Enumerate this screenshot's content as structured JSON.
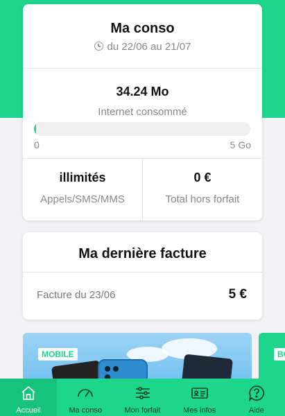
{
  "conso_card": {
    "title": "Ma conso",
    "period": "du 22/06 au 21/07",
    "data_used": "34.24 Mo",
    "data_caption": "Internet consommé",
    "usage_fraction": 0.0067,
    "range_min": "0",
    "range_max": "5 Go",
    "calls_value": "illimités",
    "calls_label": "Appels/SMS/MMS",
    "extra_value": "0 €",
    "extra_label": "Total hors forfait"
  },
  "facture_card": {
    "title": "Ma dernière facture",
    "row_label": "Facture du 23/06",
    "row_amount": "5 €"
  },
  "promo": {
    "tag": "MOBILE",
    "second_tag": "BO"
  },
  "bottom_nav": {
    "items": [
      {
        "label": "Accueil",
        "icon": "home-icon",
        "active": true
      },
      {
        "label": "Ma conso",
        "icon": "gauge-icon",
        "active": false
      },
      {
        "label": "Mon forfait",
        "icon": "sliders-icon",
        "active": false
      },
      {
        "label": "Mes infos",
        "icon": "id-card-icon",
        "active": false
      },
      {
        "label": "Aide",
        "icon": "help-icon",
        "active": false
      }
    ]
  },
  "colors": {
    "brand": "#1ed68b",
    "brand_dark": "#17c27c",
    "background": "#f2f2f5"
  }
}
